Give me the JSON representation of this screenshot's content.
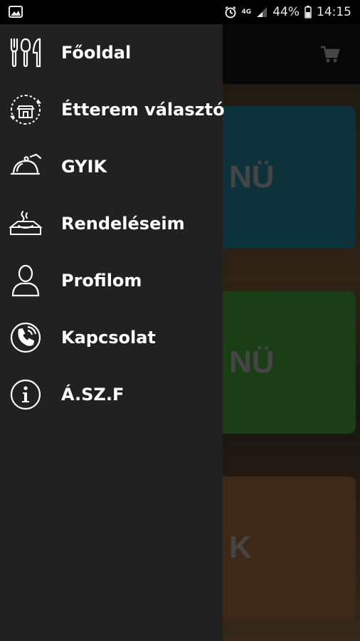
{
  "status_bar": {
    "network": "4G",
    "battery_percent": "44%",
    "time": "14:15"
  },
  "background_app": {
    "cards": [
      {
        "label": "NÜ",
        "color": "#1f6f84"
      },
      {
        "label": "NÜ",
        "color": "#3c8a34"
      },
      {
        "label": "K",
        "color": "#8b5a33"
      }
    ]
  },
  "drawer": {
    "items": [
      {
        "label": "Főoldal",
        "icon": "cutlery-icon"
      },
      {
        "label": "Étterem választó",
        "icon": "restaurant-select-icon"
      },
      {
        "label": "GYIK",
        "icon": "cloche-icon"
      },
      {
        "label": "Rendeléseim",
        "icon": "food-box-icon"
      },
      {
        "label": "Profilom",
        "icon": "user-icon"
      },
      {
        "label": "Kapcsolat",
        "icon": "phone-icon"
      },
      {
        "label": "Á.SZ.F",
        "icon": "info-icon"
      }
    ]
  }
}
